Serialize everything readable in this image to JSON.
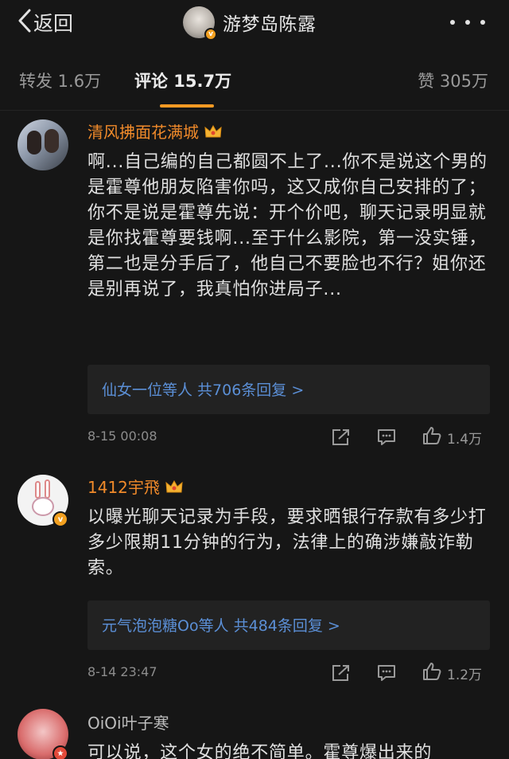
{
  "header": {
    "back_label": "返回",
    "title": "游梦岛陈露"
  },
  "tabs": [
    {
      "label": "转发 1.6万",
      "active": false
    },
    {
      "label": "评论 15.7万",
      "active": true
    },
    {
      "label": "赞 305万",
      "active": false
    }
  ],
  "colors": {
    "accent": "#f59a23",
    "username": "#f08a2a",
    "link": "#5b8fd6",
    "background": "#161616",
    "reply_box": "#222222"
  },
  "comments": [
    {
      "username": "清风拂面花满城",
      "text": "啊...自己编的自己都圆不上了...你不是说这个男的是霍尊他朋友陷害你吗，这又成你自己安排的了；你不是说是霍尊先说：开个价吧，聊天记录明显就是你找霍尊要钱啊...至于什么影院，第一没实锤，第二也是分手后了，他自己不要脸也不行？姐你还是别再说了，我真怕你进局子...",
      "replies": "仙女一位等人 共706条回复 >",
      "time": "8-15 00:08",
      "likes": "1.4万"
    },
    {
      "username": "1412宇飛",
      "text": "以曝光聊天记录为手段，要求晒银行存款有多少打多少限期11分钟的行为，法律上的确涉嫌敲诈勒索。",
      "replies": "元气泡泡糖Oo等人 共484条回复 >",
      "time": "8-14 23:47",
      "likes": "1.2万"
    },
    {
      "username": "OiOi叶子寒",
      "text": "可以说，这个女的绝不简单。霍尊爆出来的"
    }
  ]
}
